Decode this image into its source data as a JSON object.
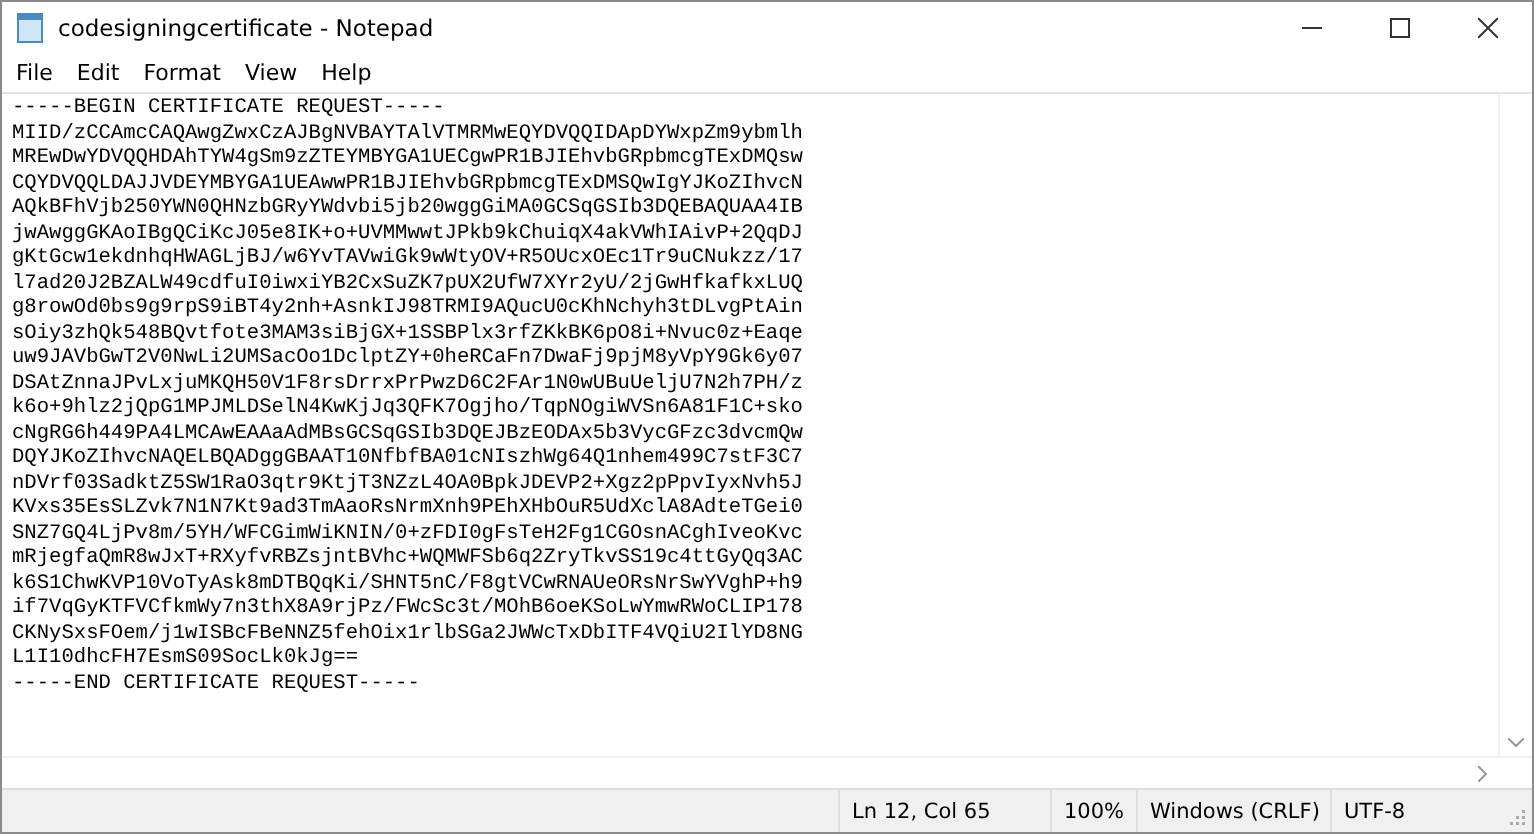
{
  "window": {
    "title": "codesigningcertificate - Notepad"
  },
  "menu": [
    "File",
    "Edit",
    "Format",
    "View",
    "Help"
  ],
  "editor": {
    "lines": [
      "-----BEGIN CERTIFICATE REQUEST-----",
      "MIID/zCCAmcCAQAwgZwxCzAJBgNVBAYTAlVTMRMwEQYDVQQIDApDYWxpZm9ybmlh",
      "MREwDwYDVQQHDAhTYW4gSm9zZTEYMBYGA1UECgwPR1BJIEhvbGRpbmcgTExDMQsw",
      "CQYDVQQLDAJJVDEYMBYGA1UEAwwPR1BJIEhvbGRpbmcgTExDMSQwIgYJKoZIhvcN",
      "AQkBFhVjb250YWN0QHNzbGRyYWdvbi5jb20wggGiMA0GCSqGSIb3DQEBAQUAA4IB",
      "jwAwggGKAoIBgQCiKcJ05e8IK+o+UVMMwwtJPkb9kChuiqX4akVWhIAivP+2QqDJ",
      "gKtGcw1ekdnhqHWAGLjBJ/w6YvTAVwiGk9wWtyOV+R5OUcxOEc1Tr9uCNukzz/17",
      "l7ad20J2BZALW49cdfuI0iwxiYB2CxSuZK7pUX2UfW7XYr2yU/2jGwHfkafkxLUQ",
      "g8rowOd0bs9g9rpS9iBT4y2nh+AsnkIJ98TRMI9AQucU0cKhNchyh3tDLvgPtAin",
      "sOiy3zhQk548BQvtfote3MAM3siBjGX+1SSBPlx3rfZKkBK6pO8i+Nvuc0z+Eaqe",
      "uw9JAVbGwT2V0NwLi2UMSacOo1DclptZY+0heRCaFn7DwaFj9pjM8yVpY9Gk6y07",
      "DSAtZnnaJPvLxjuMKQH50V1F8rsDrrxPrPwzD6C2FAr1N0wUBuUeljU7N2h7PH/z",
      "k6o+9hlz2jQpG1MPJMLDSelN4KwKjJq3QFK7Ogjho/TqpNOgiWVSn6A81F1C+sko",
      "cNgRG6h449PA4LMCAwEAAaAdMBsGCSqGSIb3DQEJBzEODAx5b3VycGFzc3dvcmQw",
      "DQYJKoZIhvcNAQELBQADggGBAAT10NfbfBA01cNIszhWg64Q1nhem499C7stF3C7",
      "nDVrf03SadktZ5SW1RaO3qtr9KtjT3NZzL4OA0BpkJDEVP2+Xgz2pPpvIyxNvh5J",
      "KVxs35EsSLZvk7N1N7Kt9ad3TmAaoRsNrmXnh9PEhXHbOuR5UdXclA8AdteTGei0",
      "SNZ7GQ4LjPv8m/5YH/WFCGimWiKNIN/0+zFDI0gFsTeH2Fg1CGOsnACghIveoKvc",
      "mRjegfaQmR8wJxT+RXyfvRBZsjntBVhc+WQMWFSb6q2ZryTkvSS19c4ttGyQq3AC",
      "k6S1ChwKVP10VoTyAsk8mDTBQqKi/SHNT5nC/F8gtVCwRNAUeORsNrSwYVghP+h9",
      "if7VqGyKTFVCfkmWy7n3thX8A9rjPz/FWcSc3t/MOhB6oeKSoLwYmwRWoCLIP178",
      "CKNySxsFOem/j1wISBcFBeNNZ5fehOix1rlbSGa2JWWcTxDbITF4VQiU2IlYD8NG",
      "L1I10dhcFH7EsmS09SocLk0kJg==",
      "-----END CERTIFICATE REQUEST-----"
    ]
  },
  "status_bar": [
    "Ln 12, Col 65",
    "100%",
    "Windows (CRLF)",
    "UTF-8"
  ]
}
